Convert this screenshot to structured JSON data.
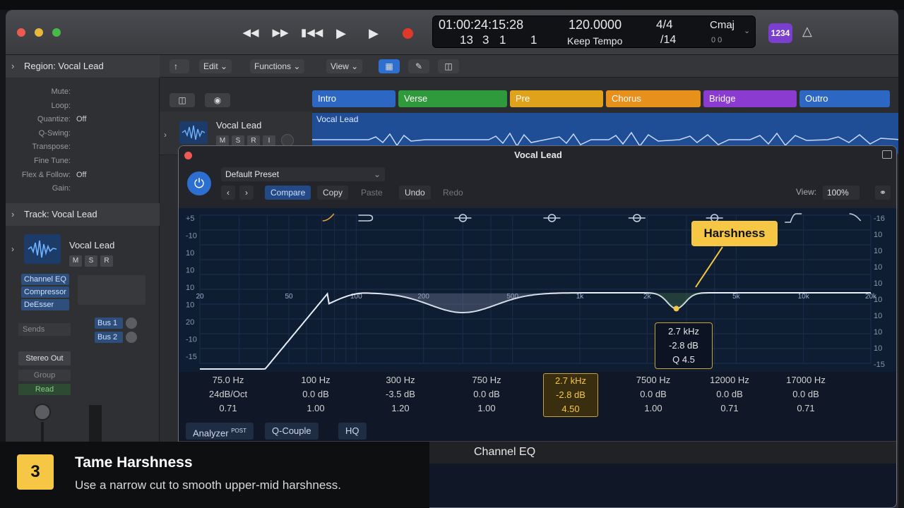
{
  "transport": {
    "buttons": [
      "rewind-icon",
      "fast-forward-icon",
      "skip-back-icon",
      "play-icon",
      "stop-icon",
      "record-icon"
    ],
    "timecode": "01:00:24:15:28",
    "bars": "13",
    "beats": "3",
    "div": "1",
    "ticks": "1",
    "tempo": "120.0000",
    "tempo_mode": "Keep Tempo",
    "signature": "4/4",
    "sig_sub": "/14",
    "key": "Cmaj",
    "key_sub": "0   0",
    "badge": "1234"
  },
  "inspector": {
    "region_title": "Region: Vocal Lead",
    "region_rows": [
      {
        "label": "Mute:",
        "value": ""
      },
      {
        "label": "Loop:",
        "value": ""
      },
      {
        "label": "Quantize:",
        "value": "Off"
      },
      {
        "label": "Q-Swing:",
        "value": ""
      },
      {
        "label": "Transpose:",
        "value": ""
      },
      {
        "label": "Fine Tune:",
        "value": ""
      },
      {
        "label": "Flex & Follow:",
        "value": "Off"
      },
      {
        "label": "Gain:",
        "value": ""
      }
    ],
    "track_title": "Track: Vocal Lead",
    "track_name": "Vocal Lead",
    "msr": [
      "M",
      "S",
      "R"
    ],
    "plugins": [
      "Channel EQ",
      "Compressor",
      "DeEsser"
    ],
    "sends_label": "Sends",
    "buses": [
      "Bus 1",
      "Bus 2"
    ],
    "output": "Stereo Out",
    "group": "Group",
    "automation": "Read"
  },
  "tracks": {
    "toolbar": {
      "edit": "Edit",
      "functions": "Functions",
      "view": "View"
    },
    "sections": [
      {
        "name": "Intro",
        "color": "#2c67c4"
      },
      {
        "name": "Verse",
        "color": "#2f9a3b"
      },
      {
        "name": "Pre",
        "color": "#e0a21a"
      },
      {
        "name": "Chorus",
        "color": "#e8901c"
      },
      {
        "name": "Bridge",
        "color": "#8b3bd0"
      },
      {
        "name": "Outro",
        "color": "#2c67c4"
      }
    ],
    "track_name": "Vocal Lead",
    "msri": [
      "M",
      "S",
      "R",
      "I"
    ],
    "region_name": "Vocal Lead"
  },
  "plugin": {
    "title": "Vocal Lead",
    "preset": "Default Preset",
    "buttons": {
      "compare": "Compare",
      "copy": "Copy",
      "paste": "Paste",
      "undo": "Undo",
      "redo": "Redo"
    },
    "view_label": "View:",
    "zoom": "100%",
    "freq_ticks": [
      "20",
      "50",
      "100",
      "200",
      "500",
      "1k",
      "2k",
      "5k",
      "10k",
      "20k"
    ],
    "db_left": [
      "+5",
      "-10",
      "10",
      "10",
      "10",
      "10",
      "20",
      "-10",
      "-15"
    ],
    "db_right": [
      "-16",
      "10",
      "10",
      "10",
      "10",
      "10",
      "10",
      "10",
      "10",
      "-15"
    ],
    "callout": "Harshness",
    "tooltip": [
      "2.7 kHz",
      "-2.8 dB",
      "Q 4.5"
    ],
    "bands": [
      {
        "freq": "75.0 Hz",
        "gain": "24dB/Oct",
        "q": "0.71"
      },
      {
        "freq": "100 Hz",
        "gain": "0.0 dB",
        "q": "1.00"
      },
      {
        "freq": "300 Hz",
        "gain": "-3.5 dB",
        "q": "1.20"
      },
      {
        "freq": "750 Hz",
        "gain": "0.0 dB",
        "q": "1.00"
      },
      {
        "freq": "2.7 kHz",
        "gain": "-2.8 dB",
        "q": "4.50"
      },
      {
        "freq": "7500 Hz",
        "gain": "0.0 dB",
        "q": "1.00"
      },
      {
        "freq": "12000 Hz",
        "gain": "0.0 dB",
        "q": "0.71"
      },
      {
        "freq": "17000 Hz",
        "gain": "0.0 dB",
        "q": "0.71"
      }
    ],
    "footer": {
      "analyzer": "Analyzer",
      "analyzer_sup": "POST",
      "qcouple": "Q-Couple",
      "hq": "HQ"
    },
    "name": "Channel EQ"
  },
  "tip": {
    "number": "3",
    "title": "Tame Harshness",
    "text": "Use a narrow cut to smooth upper-mid harshness."
  },
  "colors": {
    "accent": "#3a7bd5",
    "highlight": "#f6c744",
    "record": "#e0392b"
  }
}
